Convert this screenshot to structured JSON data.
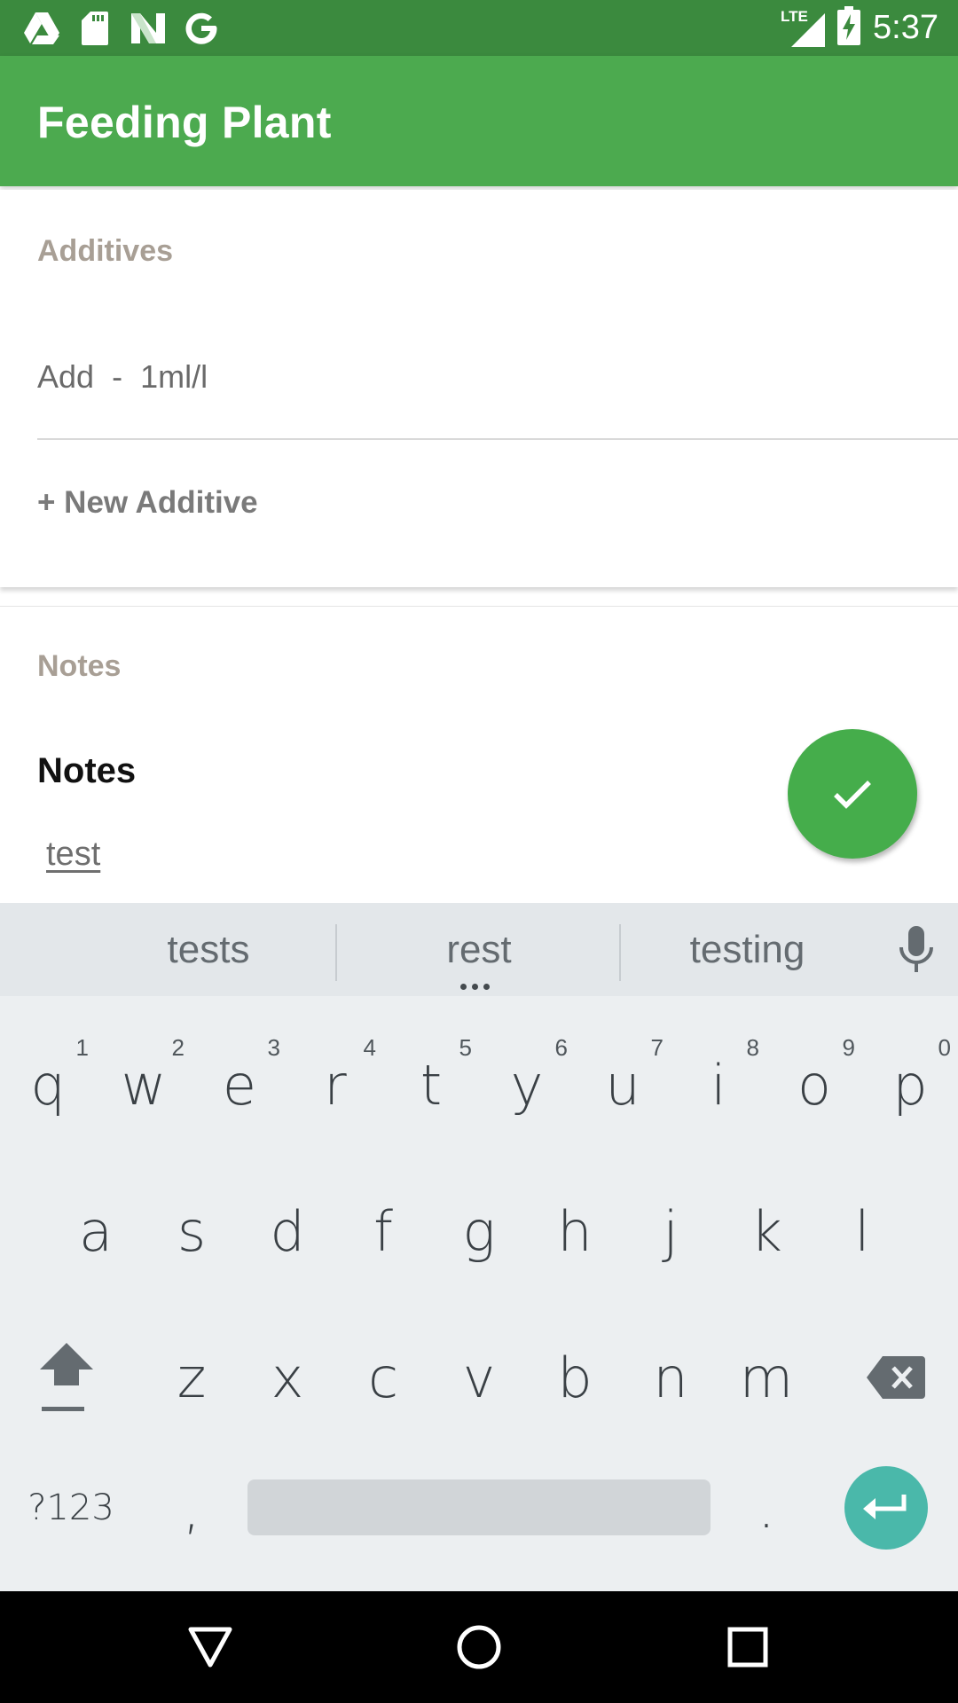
{
  "status_bar": {
    "time": "5:37",
    "network": "LTE",
    "icons": [
      "drive-icon",
      "sd-card-icon",
      "n-icon",
      "google-icon",
      "lte-signal-icon",
      "battery-charging-icon"
    ]
  },
  "app_bar": {
    "title": "Feeding Plant"
  },
  "additives": {
    "section_title": "Additives",
    "items": [
      {
        "name": "Add",
        "separator": "-",
        "amount": "1ml/l"
      }
    ],
    "new_button": "+ New Additive"
  },
  "notes": {
    "section_title": "Notes",
    "label": "Notes",
    "value": "test"
  },
  "fab": {
    "icon": "check-icon"
  },
  "keyboard": {
    "suggestions": [
      "tests",
      "rest",
      "testing"
    ],
    "row1": [
      {
        "k": "q",
        "h": "1"
      },
      {
        "k": "w",
        "h": "2"
      },
      {
        "k": "e",
        "h": "3"
      },
      {
        "k": "r",
        "h": "4"
      },
      {
        "k": "t",
        "h": "5"
      },
      {
        "k": "y",
        "h": "6"
      },
      {
        "k": "u",
        "h": "7"
      },
      {
        "k": "i",
        "h": "8"
      },
      {
        "k": "o",
        "h": "9"
      },
      {
        "k": "p",
        "h": "0"
      }
    ],
    "row2": [
      "a",
      "s",
      "d",
      "f",
      "g",
      "h",
      "j",
      "k",
      "l"
    ],
    "row3": [
      "z",
      "x",
      "c",
      "v",
      "b",
      "n",
      "m"
    ],
    "symbols_key": "?123",
    "comma_key": ",",
    "period_key": "."
  },
  "colors": {
    "status_bar": "#3b8a3e",
    "app_bar": "#4caa4f",
    "fab": "#45ad4b",
    "enter_key": "#4ab8aa",
    "section_title": "#a89f95"
  }
}
